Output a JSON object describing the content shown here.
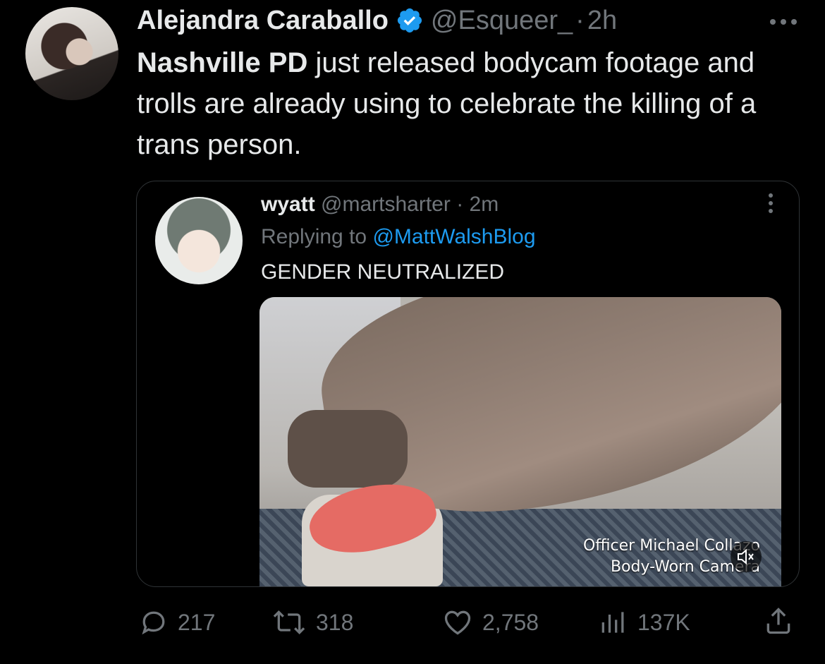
{
  "tweet": {
    "author_name": "Alejandra Caraballo",
    "handle": "@Esqueer_",
    "separator": "·",
    "time": "2h",
    "more_icon": "more-horizontal-icon",
    "text_bold": "Nashville PD",
    "text_rest": " just released bodycam footage and trolls are already using to celebrate the killing of a trans person.",
    "verified_color": "#1d9bf0"
  },
  "quote": {
    "author_name": "wyatt",
    "handle": "@martsharter",
    "separator": "·",
    "time": "2m",
    "replying_prefix": "Replying to ",
    "replying_to": "@MattWalshBlog",
    "text": "GENDER NEUTRALIZED",
    "media_caption_line1": "Officer Michael Collazo",
    "media_caption_line2": "Body-Worn Camera"
  },
  "actions": {
    "replies": "217",
    "retweets": "318",
    "likes": "2,758",
    "views": "137K"
  },
  "colors": {
    "background": "#000000",
    "text": "#e7e9ea",
    "secondary": "#71767b",
    "accent": "#1d9bf0",
    "border": "#2f3336"
  }
}
